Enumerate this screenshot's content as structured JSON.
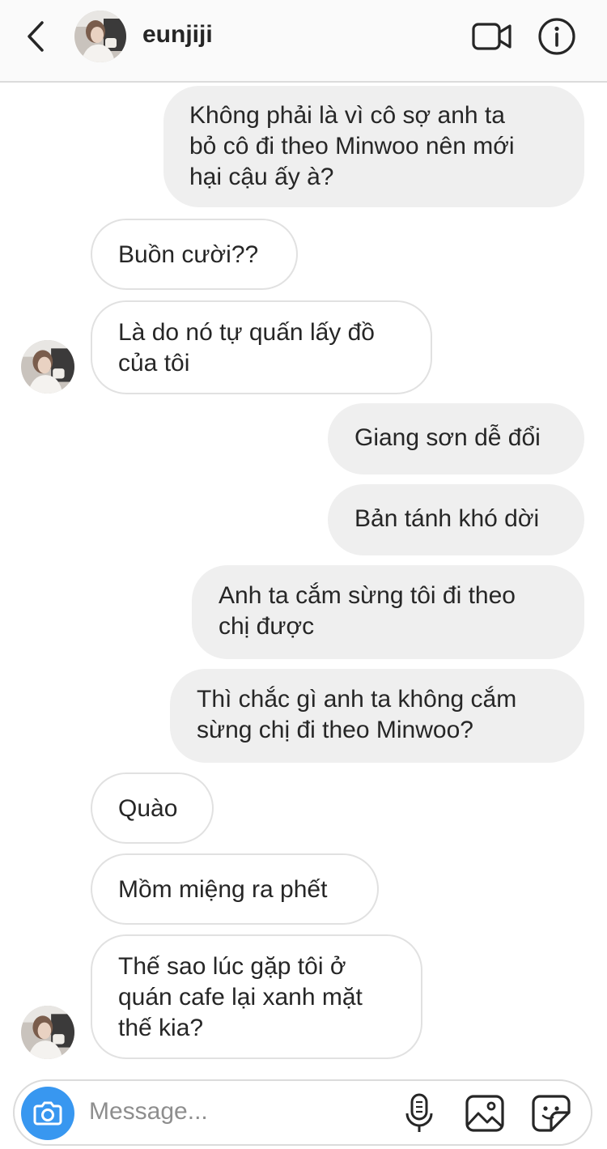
{
  "header": {
    "username": "eunjiji",
    "icons": [
      "back-icon",
      "avatar",
      "video-camera-icon",
      "info-icon"
    ]
  },
  "messages": [
    {
      "side": "sent",
      "text": "Không phải là vì cô sợ anh ta\nbỏ cô đi theo Minwoo nên mới\nhại cậu ấy à?"
    },
    {
      "side": "recv",
      "text": "Buồn cười??"
    },
    {
      "side": "recv",
      "text": "Là do nó tự quấn lấy đồ\ncủa tôi"
    },
    {
      "side": "sent",
      "text": "Giang sơn dễ đổi"
    },
    {
      "side": "sent",
      "text": "Bản tánh khó dời"
    },
    {
      "side": "sent",
      "text": "Anh ta cắm sừng tôi đi theo\nchị được"
    },
    {
      "side": "sent",
      "text": "Thì chắc gì anh ta không cắm\nsừng chị đi theo Minwoo?"
    },
    {
      "side": "recv",
      "text": "Quào"
    },
    {
      "side": "recv",
      "text": "Mồm miệng ra phết"
    },
    {
      "side": "recv",
      "text": "Thế sao lúc gặp tôi ở\nquán cafe lại xanh mặt\nthế kia?"
    }
  ],
  "composer": {
    "placeholder": "Message...",
    "icons": [
      "camera-icon",
      "microphone-icon",
      "gallery-icon",
      "sticker-icon"
    ]
  },
  "colors": {
    "sent_bubble": "#efefef",
    "received_bubble_border": "#e1e1e1",
    "camera_button": "#3897f0",
    "placeholder": "#8e8e8e"
  }
}
